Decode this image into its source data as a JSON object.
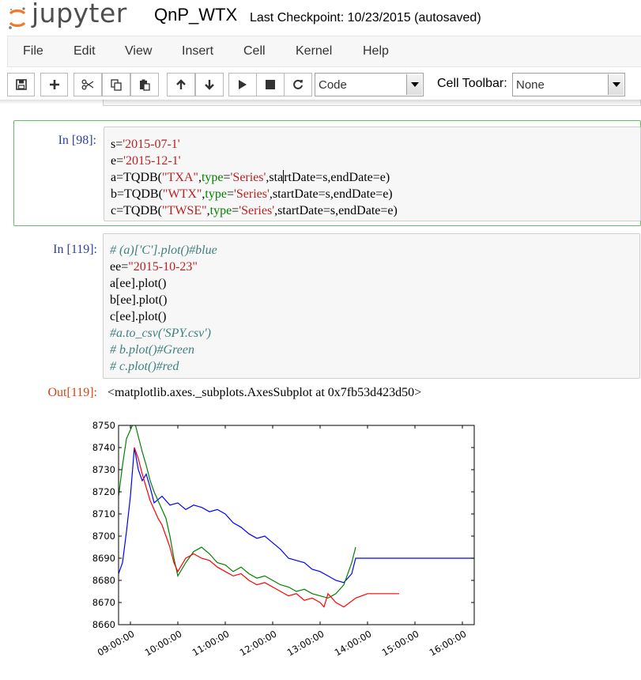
{
  "header": {
    "logo_text": "jupyter",
    "notebook_name": "QnP_WTX",
    "checkpoint": "Last Checkpoint: 10/23/2015 (autosaved)"
  },
  "menubar": {
    "items": [
      "File",
      "Edit",
      "View",
      "Insert",
      "Cell",
      "Kernel",
      "Help"
    ]
  },
  "toolbar": {
    "buttons": [
      "save-icon",
      "plus-icon",
      "cut-icon",
      "copy-icon",
      "paste-icon",
      "arrow-up-icon",
      "arrow-down-icon",
      "play-icon",
      "stop-icon",
      "refresh-icon"
    ],
    "cell_type": "Code",
    "cell_toolbar_label": "Cell Toolbar:",
    "cell_toolbar_value": "None"
  },
  "cells": [
    {
      "prompt": "In [98]:",
      "lines": [
        "s='2015-07-1'",
        "e='2015-12-1'",
        "a=TQDB(\"TXA\",type='Series',startDate=s,endDate=e)",
        "b=TQDB(\"WTX\",type='Series',startDate=s,endDate=e)",
        "c=TQDB(\"TWSE\",type='Series',startDate=s,endDate=e)"
      ]
    },
    {
      "prompt": "In [119]:",
      "lines": [
        "# (a)['C'].plot()#blue",
        "ee=\"2015-10-23\"",
        "a[ee].plot()",
        "b[ee].plot()",
        "c[ee].plot()",
        "#a.to_csv('SPY.csv')",
        "# b.plot()#Green",
        "# c.plot()#red"
      ],
      "out_prompt": "Out[119]:",
      "out_text": "<matplotlib.axes._subplots.AxesSubplot at 0x7fb53d423d50>"
    }
  ],
  "chart_data": {
    "type": "line",
    "xlabel": "",
    "ylabel": "",
    "x_ticks": [
      "09:00:00",
      "10:00:00",
      "11:00:00",
      "12:00:00",
      "13:00:00",
      "14:00:00",
      "15:00:00",
      "16:00:00"
    ],
    "y_ticks": [
      8660,
      8670,
      8680,
      8690,
      8700,
      8710,
      8720,
      8730,
      8740,
      8750
    ],
    "xlim": [
      "08:45",
      "16:15"
    ],
    "ylim": [
      8660,
      8750
    ],
    "grid": false,
    "legend": "none",
    "series": [
      {
        "color": "#0000ff",
        "x": [
          "08:45",
          "08:50",
          "08:55",
          "09:00",
          "09:05",
          "09:10",
          "09:15",
          "09:20",
          "09:25",
          "09:30",
          "09:40",
          "09:50",
          "10:00",
          "10:10",
          "10:20",
          "10:30",
          "10:40",
          "10:50",
          "11:00",
          "11:10",
          "11:20",
          "11:30",
          "11:40",
          "11:50",
          "12:00",
          "12:10",
          "12:20",
          "12:30",
          "12:40",
          "12:50",
          "13:00",
          "13:10",
          "13:20",
          "13:30",
          "13:40",
          "13:45",
          "14:00",
          "15:00",
          "16:00",
          "16:15"
        ],
        "y": [
          8683,
          8688,
          8702,
          8718,
          8740,
          8730,
          8725,
          8728,
          8722,
          8715,
          8718,
          8714,
          8715,
          8712,
          8714,
          8713,
          8711,
          8712,
          8710,
          8706,
          8704,
          8701,
          8699,
          8700,
          8697,
          8694,
          8690,
          8689,
          8688,
          8685,
          8684,
          8682,
          8680,
          8679,
          8683,
          8690,
          8690,
          8690,
          8690,
          8690
        ]
      },
      {
        "color": "#008000",
        "x": [
          "08:45",
          "08:50",
          "08:55",
          "09:00",
          "09:05",
          "09:10",
          "09:15",
          "09:20",
          "09:25",
          "09:30",
          "09:35",
          "09:40",
          "09:45",
          "09:50",
          "09:55",
          "10:00",
          "10:10",
          "10:20",
          "10:30",
          "10:40",
          "10:50",
          "11:00",
          "11:10",
          "11:20",
          "11:30",
          "11:40",
          "11:50",
          "12:00",
          "12:10",
          "12:20",
          "12:30",
          "12:40",
          "12:50",
          "13:00",
          "13:10",
          "13:20",
          "13:30",
          "13:40",
          "13:45"
        ],
        "y": [
          8718,
          8732,
          8744,
          8748,
          8752,
          8745,
          8738,
          8732,
          8725,
          8720,
          8716,
          8712,
          8708,
          8700,
          8690,
          8682,
          8688,
          8693,
          8695,
          8692,
          8688,
          8687,
          8684,
          8686,
          8683,
          8681,
          8682,
          8680,
          8678,
          8677,
          8675,
          8676,
          8674,
          8673,
          8672,
          8674,
          8678,
          8688,
          8695
        ]
      },
      {
        "color": "#ff0000",
        "x": [
          "09:05",
          "09:10",
          "09:15",
          "09:20",
          "09:25",
          "09:30",
          "09:35",
          "09:40",
          "09:45",
          "09:50",
          "09:55",
          "10:00",
          "10:10",
          "10:20",
          "10:30",
          "10:40",
          "10:50",
          "11:00",
          "11:10",
          "11:20",
          "11:30",
          "11:40",
          "11:50",
          "12:00",
          "12:10",
          "12:20",
          "12:30",
          "12:40",
          "12:50",
          "13:00",
          "13:05",
          "13:10",
          "13:20",
          "13:30",
          "13:45",
          "14:00",
          "14:30",
          "14:40"
        ],
        "y": [
          8740,
          8735,
          8728,
          8722,
          8716,
          8712,
          8708,
          8705,
          8700,
          8695,
          8688,
          8684,
          8690,
          8692,
          8690,
          8689,
          8686,
          8684,
          8682,
          8683,
          8680,
          8678,
          8679,
          8677,
          8675,
          8673,
          8674,
          8671,
          8672,
          8670,
          8668,
          8674,
          8670,
          8668,
          8672,
          8674,
          8674,
          8674
        ]
      }
    ]
  }
}
